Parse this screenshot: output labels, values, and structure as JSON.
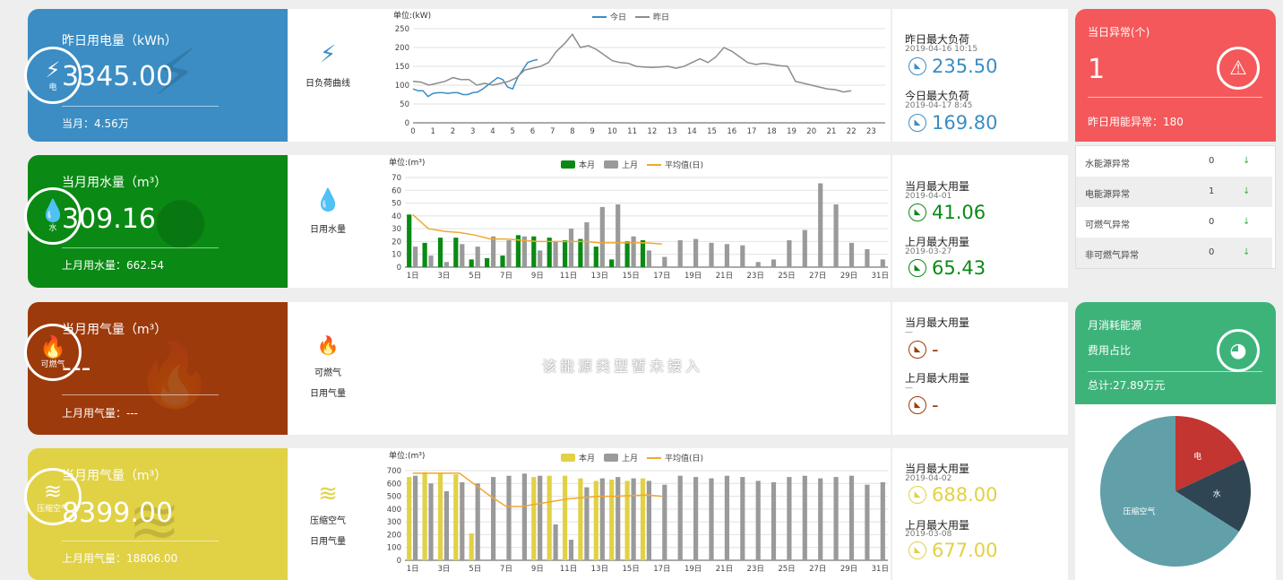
{
  "electric": {
    "title": "昨日用电量（kWh）",
    "value": "3345.00",
    "sub": "当月：4.56万",
    "badge": "电",
    "color": "#3b8dc4",
    "icon_label": "日负荷曲线",
    "peak_yesterday": {
      "label": "昨日最大负荷",
      "date": "2019-04-16 10:15",
      "value": "235.50"
    },
    "peak_today": {
      "label": "今日最大负荷",
      "date": "2019-04-17 8:45",
      "value": "169.80"
    }
  },
  "water": {
    "title": "当月用水量（m³）",
    "value": "309.16",
    "sub": "上月用水量：662.54",
    "badge": "水",
    "color": "#0a8a14",
    "icon_label": "日用水量",
    "max_cur": {
      "label": "当月最大用量",
      "date": "2019-04-01",
      "value": "41.06"
    },
    "max_prev": {
      "label": "上月最大用量",
      "date": "2019-03-27",
      "value": "65.43"
    }
  },
  "gas": {
    "title": "当月用气量（m³）",
    "value": "---",
    "sub": "上月用气量：---",
    "badge": "可燃气",
    "color": "#9c3a0c",
    "icon_label1": "可燃气",
    "icon_label2": "日用气量",
    "placeholder": "该能源类型暂未接入",
    "max_cur": {
      "label": "当月最大用量",
      "date": "—",
      "value": "-"
    },
    "max_prev": {
      "label": "上月最大用量",
      "date": "—",
      "value": "-"
    }
  },
  "air": {
    "title": "当月用气量（m³）",
    "value": "8399.00",
    "sub": "上月用气量：18806.00",
    "badge": "压缩空气",
    "color": "#e1d145",
    "icon_label1": "压缩空气",
    "icon_label2": "日用气量",
    "max_cur": {
      "label": "当月最大用量",
      "date": "2019-04-02",
      "value": "688.00"
    },
    "max_prev": {
      "label": "上月最大用量",
      "date": "2019-03-08",
      "value": "677.00"
    }
  },
  "anomaly": {
    "title": "当日异常(个)",
    "value": "1",
    "sub": "昨日用能异常：180",
    "color": "#f4585a",
    "rows": [
      {
        "name": "水能源异常",
        "count": "0"
      },
      {
        "name": "电能源异常",
        "count": "1"
      },
      {
        "name": "可燃气异常",
        "count": "0"
      },
      {
        "name": "非可燃气异常",
        "count": "0"
      }
    ]
  },
  "cost": {
    "title1": "月消耗能源",
    "title2": "费用占比",
    "total": "总计:27.89万元",
    "color": "#3db37a"
  },
  "chart_data": [
    {
      "type": "line",
      "ylabel": "单位:(kW)",
      "x": [
        0,
        1,
        2,
        3,
        4,
        5,
        6,
        7,
        8,
        9,
        10,
        11,
        12,
        13,
        14,
        15,
        16,
        17,
        18,
        19,
        20,
        21,
        22,
        23
      ],
      "ylim": [
        0,
        250
      ],
      "yticks": [
        0,
        50,
        100,
        150,
        200,
        250
      ],
      "series": [
        {
          "name": "今日",
          "color": "#3b8dc4",
          "values": [
            90,
            85,
            85,
            70,
            78,
            80,
            80,
            78,
            80,
            80,
            75,
            75,
            80,
            82,
            90,
            100,
            110,
            120,
            115,
            95,
            90,
            120,
            140,
            160,
            165,
            168
          ]
        },
        {
          "name": "昨日",
          "color": "#8c8c8c",
          "values": [
            110,
            108,
            100,
            105,
            110,
            120,
            115,
            115,
            100,
            105,
            100,
            105,
            110,
            120,
            140,
            145,
            150,
            160,
            190,
            210,
            235,
            200,
            205,
            195,
            180,
            165,
            160,
            158,
            150,
            148,
            147,
            148,
            150,
            145,
            150,
            160,
            170,
            160,
            175,
            200,
            190,
            175,
            160,
            155,
            158,
            155,
            152,
            150,
            110,
            105,
            100,
            95,
            90,
            88,
            82,
            85
          ]
        }
      ],
      "grid": true,
      "legend": "top-center"
    },
    {
      "type": "bar",
      "ylabel": "单位:(m³)",
      "categories": [
        "1日",
        "2日",
        "3日",
        "4日",
        "5日",
        "6日",
        "7日",
        "8日",
        "9日",
        "10日",
        "11日",
        "12日",
        "13日",
        "14日",
        "15日",
        "16日",
        "17日",
        "18日",
        "19日",
        "20日",
        "21日",
        "22日",
        "23日",
        "24日",
        "25日",
        "26日",
        "27日",
        "28日",
        "29日",
        "30日",
        "31日"
      ],
      "xticks": [
        "1日",
        "3日",
        "5日",
        "7日",
        "9日",
        "11日",
        "13日",
        "15日",
        "17日",
        "19日",
        "21日",
        "23日",
        "25日",
        "27日",
        "29日",
        "31日"
      ],
      "ylim": [
        0,
        70
      ],
      "yticks": [
        0,
        10,
        20,
        30,
        40,
        50,
        60,
        70
      ],
      "series": [
        {
          "name": "本月",
          "color": "#0a8a14",
          "values": [
            41.06,
            19,
            23,
            23,
            6,
            7,
            9,
            25,
            24,
            23,
            21,
            22,
            16,
            6,
            20,
            21,
            null,
            null,
            null,
            null,
            null,
            null,
            null,
            null,
            null,
            null,
            null,
            null,
            null,
            null,
            null
          ]
        },
        {
          "name": "上月",
          "color": "#9a9a9a",
          "values": [
            16,
            9,
            4,
            18,
            16,
            24,
            21,
            24,
            13,
            20,
            30,
            35,
            47,
            49,
            24,
            13,
            8,
            21,
            22,
            19,
            18,
            17,
            4,
            6,
            21,
            29,
            65.43,
            49,
            19,
            14,
            6
          ]
        },
        {
          "name": "平均值(日)",
          "color": "#f0a830",
          "values": [
            41,
            30,
            28,
            27,
            25,
            22,
            22,
            21,
            20,
            20,
            20,
            20,
            19,
            19,
            19,
            19,
            18
          ]
        }
      ],
      "grid": true,
      "legend": "top-center"
    },
    {
      "type": "bar",
      "ylabel": "单位:(m³)",
      "categories": [
        "1日",
        "2日",
        "3日",
        "4日",
        "5日",
        "6日",
        "7日",
        "8日",
        "9日",
        "10日",
        "11日",
        "12日",
        "13日",
        "14日",
        "15日",
        "16日",
        "17日",
        "18日",
        "19日",
        "20日",
        "21日",
        "22日",
        "23日",
        "24日",
        "25日",
        "26日",
        "27日",
        "28日",
        "29日",
        "30日",
        "31日"
      ],
      "xticks": [
        "1日",
        "3日",
        "5日",
        "7日",
        "9日",
        "11日",
        "13日",
        "15日",
        "17日",
        "19日",
        "21日",
        "23日",
        "25日",
        "27日",
        "29日",
        "31日"
      ],
      "ylim": [
        0,
        700
      ],
      "yticks": [
        0,
        100,
        200,
        300,
        400,
        500,
        600,
        700
      ],
      "series": [
        {
          "name": "本月",
          "color": "#e1d145",
          "values": [
            650,
            688,
            680,
            670,
            210,
            null,
            null,
            null,
            650,
            660,
            660,
            640,
            620,
            630,
            620,
            640,
            null,
            null,
            null,
            null,
            null,
            null,
            null,
            null,
            null,
            null,
            null,
            null,
            null,
            null,
            null
          ]
        },
        {
          "name": "上月",
          "color": "#9a9a9a",
          "values": [
            660,
            600,
            540,
            610,
            600,
            650,
            660,
            677,
            660,
            280,
            160,
            570,
            640,
            650,
            640,
            620,
            590,
            660,
            650,
            640,
            660,
            650,
            620,
            610,
            650,
            660,
            640,
            650,
            660,
            590,
            610
          ]
        },
        {
          "name": "平均值(日)",
          "color": "#f0a830",
          "values": [
            680,
            680,
            680,
            680,
            590,
            500,
            420,
            420,
            440,
            460,
            480,
            490,
            500,
            500,
            505,
            510,
            500
          ]
        }
      ],
      "grid": true,
      "legend": "top-center"
    },
    {
      "type": "pie",
      "labels": [
        "电",
        "水",
        "压缩空气"
      ],
      "values": [
        18,
        16,
        66
      ],
      "colors": [
        "#c23531",
        "#2f4554",
        "#61a0a8"
      ]
    }
  ]
}
